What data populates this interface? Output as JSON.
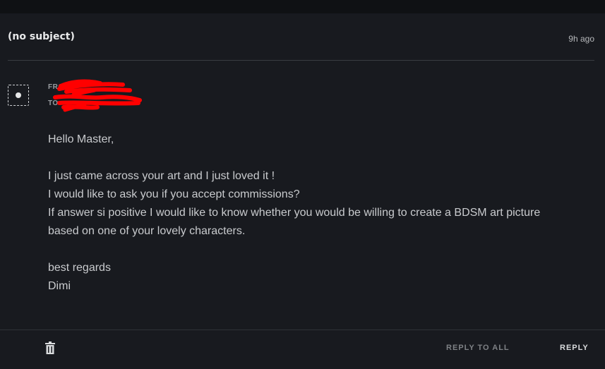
{
  "header": {
    "subject": "(no subject)",
    "time_ago": "9h ago"
  },
  "message": {
    "from_label": "FROM",
    "to_label": "TO",
    "lines": [
      "Hello Master,",
      "",
      "I just came across your art and I just loved it !",
      "I would like to ask you if you accept commissions?",
      "If answer si positive I would like to know whether you would be willing to create a BDSM art picture",
      "based on one of your lovely characters.",
      "",
      "best regards",
      "Dimi"
    ]
  },
  "footer": {
    "reply_all_label": "REPLY TO ALL",
    "reply_label": "REPLY"
  },
  "icons": {
    "avatar": "avatar-icon",
    "delete": "trash-icon"
  },
  "colors": {
    "background": "#181a1f",
    "redaction": "#ff0000"
  }
}
